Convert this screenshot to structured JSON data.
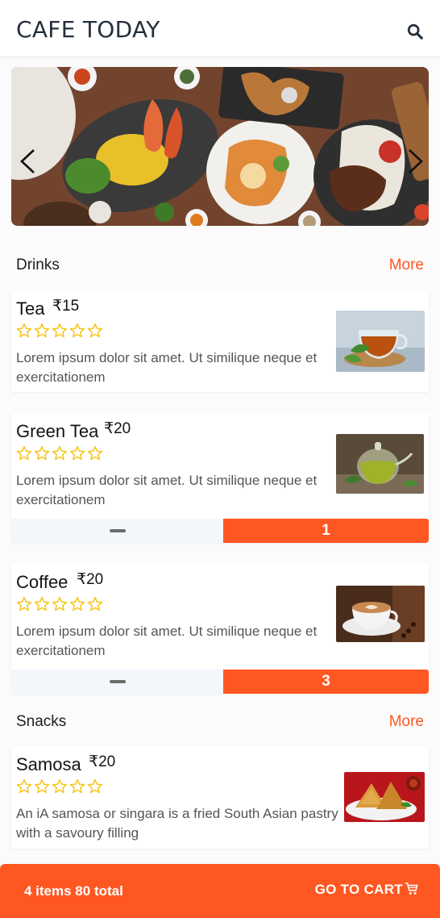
{
  "header": {
    "title": "CAFE TODAY",
    "search_icon": "search-icon"
  },
  "carousel": {
    "image": "food-platter-banner",
    "prev_icon": "chevron-left-icon",
    "next_icon": "chevron-right-icon"
  },
  "sections": [
    {
      "name": "Drinks",
      "more": "More",
      "items": [
        {
          "name": "Tea",
          "price": "₹15",
          "rating": 0,
          "max_rating": 5,
          "description": "Lorem ipsum dolor sit amet. Ut similique neque et exercitationem",
          "image": "tea-cup-image"
        },
        {
          "name": "Green Tea",
          "price": "₹20",
          "rating": 0,
          "max_rating": 5,
          "description": "Lorem ipsum dolor sit amet. Ut similique neque et exercitationem",
          "image": "green-tea-pot-image",
          "quantity": "1"
        },
        {
          "name": "Coffee",
          "price": "₹20",
          "rating": 0,
          "max_rating": 5,
          "description": "Lorem ipsum dolor sit amet. Ut similique neque et exercitationem",
          "image": "coffee-cup-image",
          "quantity": "3"
        }
      ]
    },
    {
      "name": "Snacks",
      "more": "More",
      "items": [
        {
          "name": "Samosa",
          "price": "₹20",
          "rating": 0,
          "max_rating": 5,
          "description": "An iA samosa or singara is a fried South Asian pastry with a savoury filling",
          "image": "samosa-plate-image"
        }
      ]
    }
  ],
  "cart": {
    "summary": "4 items 80 total",
    "button_label": "GO TO CART",
    "icon": "cart-icon"
  },
  "colors": {
    "accent": "#ff5722",
    "star": "#f5c518",
    "title": "#252f3a",
    "qty_bg": "#f3f6fb"
  }
}
